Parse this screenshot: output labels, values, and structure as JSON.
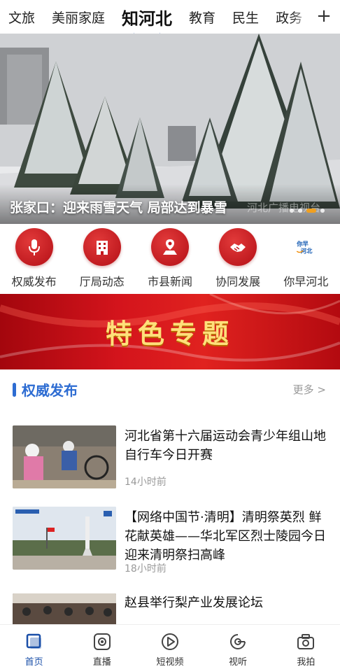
{
  "top_tabs": [
    {
      "label": "文旅"
    },
    {
      "label": "美丽家庭"
    },
    {
      "label": "知河北"
    },
    {
      "label": "教育"
    },
    {
      "label": "民生"
    },
    {
      "label": "政务"
    }
  ],
  "active_tab": "知河北",
  "hero": {
    "caption": "张家口：迎来雨雪天气 局部达到暴雪",
    "watermark": "河北广播电视台",
    "slide_count": 4,
    "active_slide": 3
  },
  "shortcuts": [
    {
      "label": "权威发布",
      "icon": "microphone-icon"
    },
    {
      "label": "厅局动态",
      "icon": "building-icon"
    },
    {
      "label": "市县新闻",
      "icon": "map-pin-icon"
    },
    {
      "label": "协同发展",
      "icon": "handshake-icon"
    },
    {
      "label": "你早河北",
      "icon": "nizao-hebei-logo",
      "logo_text": "你早河北"
    }
  ],
  "banner": {
    "title": "特色专题"
  },
  "section": {
    "title": "权威发布",
    "more": "更多 >"
  },
  "news": [
    {
      "title": "河北省第十六届运动会青少年组山地自行车今日开赛",
      "time": "14小时前"
    },
    {
      "title": "【网络中国节·清明】清明祭英烈 鲜花献英雄——华北军区烈士陵园今日迎来清明祭扫高峰",
      "time": "18小时前"
    },
    {
      "title": "赵县举行梨产业发展论坛",
      "time": ""
    }
  ],
  "bottom_nav": [
    {
      "label": "首页",
      "icon": "home-icon",
      "active": true
    },
    {
      "label": "直播",
      "icon": "live-icon",
      "active": false
    },
    {
      "label": "短视频",
      "icon": "play-icon",
      "active": false
    },
    {
      "label": "视听",
      "icon": "audio-icon",
      "active": false
    },
    {
      "label": "我拍",
      "icon": "camera-icon",
      "active": false
    }
  ],
  "colors": {
    "accent_blue": "#2d6cd2",
    "nav_blue": "#1a4fa8",
    "brand_red": "#d4141c",
    "banner_gold": "#ffe07a"
  }
}
